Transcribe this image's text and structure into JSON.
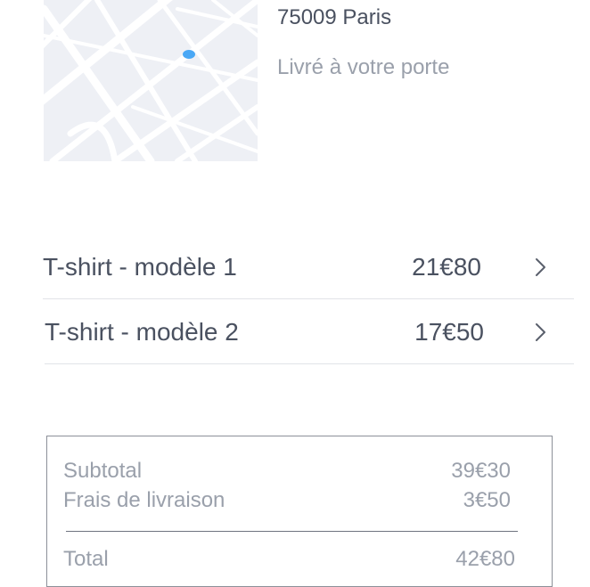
{
  "delivery": {
    "city": "75009 Paris",
    "note": "Livré à votre porte",
    "map_pin_color": "#4aa8f5"
  },
  "items": [
    {
      "name": "T-shirt - modèle 1",
      "price": "21€80",
      "icon": "chevron-right-icon"
    },
    {
      "name": "T-shirt - modèle 2",
      "price": "17€50",
      "icon": "chevron-right-icon"
    }
  ],
  "summary": {
    "subtotal_label": "Subtotal",
    "subtotal_value": "39€30",
    "shipping_label": "Frais de livraison",
    "shipping_value": "3€50",
    "total_label": "Total",
    "total_value": "42€80"
  },
  "colors": {
    "text": "#4a5160",
    "muted": "#9aa0ab",
    "map_bg": "#eef0f5",
    "divider": "#e1e3e8"
  }
}
